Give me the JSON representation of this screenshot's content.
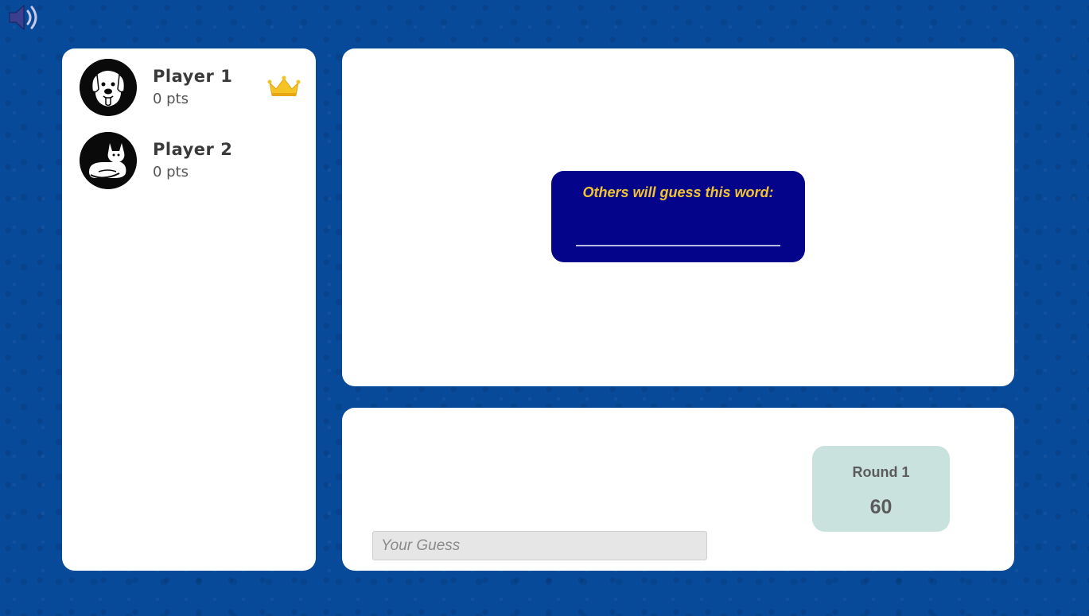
{
  "sound": {
    "icon": "speaker-icon"
  },
  "players": [
    {
      "name": "Player 1",
      "score": "0 pts",
      "avatar": "dog-icon",
      "is_leader": true
    },
    {
      "name": "Player 2",
      "score": "0 pts",
      "avatar": "cat-icon",
      "is_leader": false
    }
  ],
  "leader_badge": {
    "icon": "crown-icon"
  },
  "drawing": {
    "hint": "Others will guess this word:",
    "word": ""
  },
  "guess": {
    "placeholder": "Your Guess",
    "value": ""
  },
  "round": {
    "label": "Round 1",
    "timer": "60"
  },
  "colors": {
    "background": "#084a9a",
    "panel": "#ffffff",
    "word_box": "#04048a",
    "hint_text": "#f1c232",
    "round_box": "#c9e2dd",
    "crown": "#f5c324"
  }
}
